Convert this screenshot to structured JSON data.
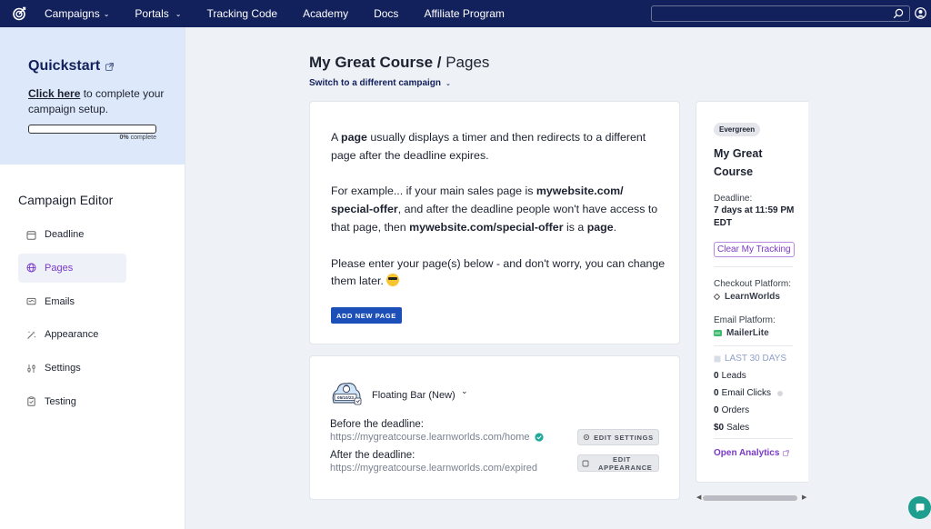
{
  "nav": {
    "items": [
      {
        "label": "Campaigns",
        "has_dropdown": true
      },
      {
        "label": "Portals",
        "has_dropdown": true
      },
      {
        "label": "Tracking Code",
        "has_dropdown": false
      },
      {
        "label": "Academy",
        "has_dropdown": false
      },
      {
        "label": "Docs",
        "has_dropdown": false
      },
      {
        "label": "Affiliate Program",
        "has_dropdown": false
      }
    ],
    "search_value": "",
    "colors": {
      "navbar": "#12205c",
      "accent_purple": "#7a39c9",
      "primary_blue": "#1d4fb8"
    }
  },
  "quickstart": {
    "title": "Quickstart",
    "link_text": "Click here",
    "text_rest": " to complete your campaign setup.",
    "progress_percent": 0,
    "progress_value": "0%",
    "progress_suffix": " complete"
  },
  "sidebar": {
    "title": "Campaign Editor",
    "items": [
      {
        "label": "Deadline",
        "icon": "calendar-icon",
        "active": false
      },
      {
        "label": "Pages",
        "icon": "globe-icon",
        "active": true
      },
      {
        "label": "Emails",
        "icon": "mail-icon",
        "active": false
      },
      {
        "label": "Appearance",
        "icon": "magic-wand-icon",
        "active": false
      },
      {
        "label": "Settings",
        "icon": "sliders-icon",
        "active": false
      },
      {
        "label": "Testing",
        "icon": "clipboard-icon",
        "active": false
      }
    ]
  },
  "header": {
    "campaign": "My Great Course",
    "separator": " / ",
    "section": "Pages",
    "switch_label": "Switch to a different campaign"
  },
  "info": {
    "p1": {
      "a": "A ",
      "b": "page",
      "c": " usually displays a timer and then redirects to a different page after the deadline expires."
    },
    "p2": {
      "a": "For example... if your main sales page is ",
      "b": "mywebsite.com/ special-offer",
      "c": ", and after the deadline people won't have access to that page, then ",
      "d": "mywebsite.com/special-offer",
      "e": " is a ",
      "f": "page",
      "g": "."
    },
    "p3": "Please enter your page(s) below - and don't worry, you can change them later. ",
    "add_button": "ADD NEW PAGE"
  },
  "page_card": {
    "icon_date": "05/10/23",
    "type_label": "Floating Bar (New)",
    "before_label": "Before the deadline:",
    "before_url": "https://mygreatcourse.learnworlds.com/home",
    "after_label": "After the deadline:",
    "after_url": "https://mygreatcourse.learnworlds.com/expired",
    "edit_settings": "EDIT SETTINGS",
    "edit_appearance": "EDIT APPEARANCE"
  },
  "panel": {
    "badge": "Evergreen",
    "course": "My Great Course",
    "deadline_label": "Deadline:",
    "deadline_value": "7 days at 11:59 PM EDT",
    "clear_tracking": "Clear My Tracking",
    "checkout_label": "Checkout Platform:",
    "checkout_value": "LearnWorlds",
    "email_label": "Email Platform:",
    "email_value": "MailerLite",
    "period": "LAST 30 DAYS",
    "stats": [
      {
        "value": "0",
        "label": "Leads"
      },
      {
        "value": "0",
        "label": "Email Clicks"
      },
      {
        "value": "0",
        "label": "Orders"
      },
      {
        "value": "$0",
        "label": "Sales"
      }
    ],
    "analytics": "Open Analytics"
  }
}
